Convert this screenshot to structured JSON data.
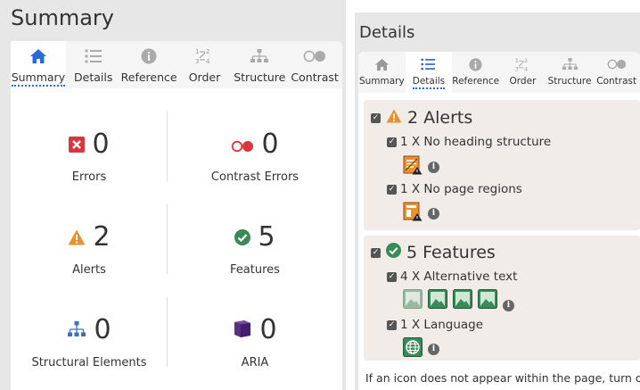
{
  "summary_panel": {
    "title": "Summary",
    "tabs": [
      {
        "label": "Summary",
        "icon": "home-icon",
        "active": true
      },
      {
        "label": "Details",
        "icon": "list-icon",
        "active": false
      },
      {
        "label": "Reference",
        "icon": "info-icon",
        "active": false
      },
      {
        "label": "Order",
        "icon": "order-icon",
        "active": false
      },
      {
        "label": "Structure",
        "icon": "structure-icon",
        "active": false
      },
      {
        "label": "Contrast",
        "icon": "contrast-icon",
        "active": false
      }
    ],
    "stats": {
      "errors": {
        "count": "0",
        "label": "Errors"
      },
      "contrast_errors": {
        "count": "0",
        "label": "Contrast Errors"
      },
      "alerts": {
        "count": "2",
        "label": "Alerts"
      },
      "features": {
        "count": "5",
        "label": "Features"
      },
      "structural": {
        "count": "0",
        "label": "Structural Elements"
      },
      "aria": {
        "count": "0",
        "label": "ARIA"
      }
    }
  },
  "details_panel": {
    "title": "Details",
    "tabs": [
      {
        "label": "Summary",
        "icon": "home-icon",
        "active": false
      },
      {
        "label": "Details",
        "icon": "list-icon",
        "active": true
      },
      {
        "label": "Reference",
        "icon": "info-icon",
        "active": false
      },
      {
        "label": "Order",
        "icon": "order-icon",
        "active": false
      },
      {
        "label": "Structure",
        "icon": "structure-icon",
        "active": false
      },
      {
        "label": "Contrast",
        "icon": "contrast-icon",
        "active": false
      }
    ],
    "alerts": {
      "heading": "2 Alerts",
      "items": [
        {
          "label": "1 X No heading structure"
        },
        {
          "label": "1 X No page regions"
        }
      ]
    },
    "features": {
      "heading": "5 Features",
      "items": [
        {
          "label": "4 X Alternative text"
        },
        {
          "label": "1 X Language"
        }
      ]
    },
    "footer_text": "If an icon does not appear within the page, turn off"
  },
  "colors": {
    "error_red": "#d9363e",
    "alert_orange": "#e8912d",
    "feature_green": "#3a8a58",
    "structure_blue": "#3d6fc1",
    "aria_purple": "#5a2d86",
    "tab_blue": "#2a6ad6"
  }
}
